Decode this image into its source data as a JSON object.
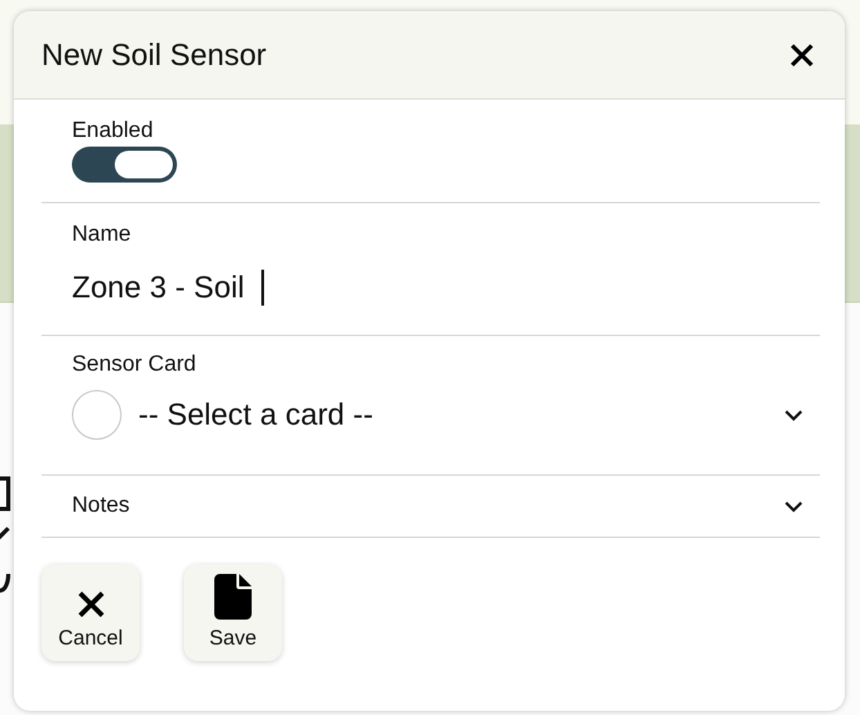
{
  "dialog": {
    "title": "New Soil Sensor"
  },
  "enabled": {
    "label": "Enabled",
    "on": true
  },
  "name": {
    "label": "Name",
    "value": "Zone 3 - Soil"
  },
  "sensor_card": {
    "label": "Sensor Card",
    "value": "-- Select a card --"
  },
  "notes": {
    "label": "Notes",
    "expanded": false
  },
  "buttons": [
    {
      "kind": "cancel",
      "label": "Cancel"
    },
    {
      "kind": "save",
      "label": "Save"
    }
  ]
}
